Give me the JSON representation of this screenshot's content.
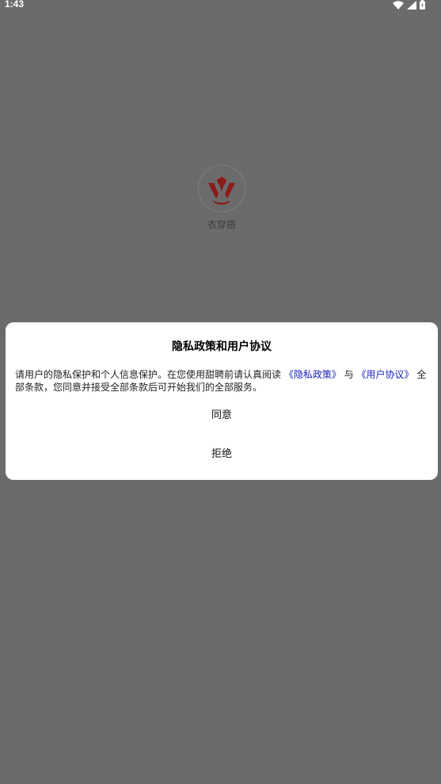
{
  "status_bar": {
    "time": "1:43"
  },
  "splash": {
    "app_name": "衣穿搭",
    "logo_color": "#8c1a1a"
  },
  "dialog": {
    "title": "隐私政策和用户协议",
    "message_prefix": "请用户的隐私保护和个人信息保护。在您使用甜聘前请认真阅读 ",
    "privacy_link": "《隐私政策》",
    "conjunction": "与",
    "agreement_link": "《用户协议》",
    "message_suffix": "全部条款，您同意并接受全部条款后可开始我们的全部服务。",
    "agree_label": "同意",
    "refuse_label": "拒绝",
    "link_color": "#1a23b8"
  }
}
